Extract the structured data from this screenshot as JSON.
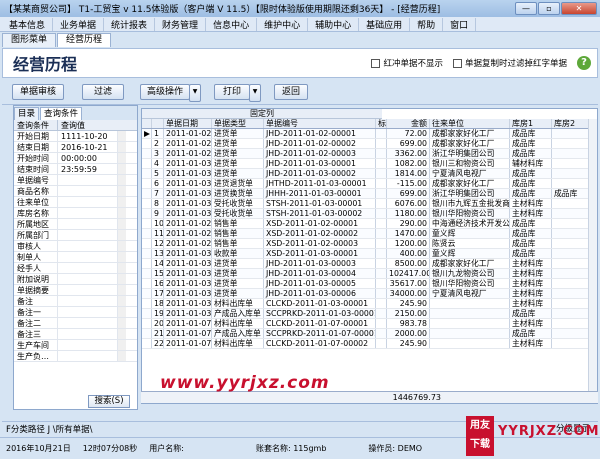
{
  "window": {
    "title": "【某某商贸公司】 T1-工贸宝 v 11.5体验版（客户端 V 11.5）【限时体验版使用期限还剩36天】 - [经营历程]",
    "btn_min": "—",
    "btn_max": "▫",
    "btn_close": "✕"
  },
  "menu": [
    "基本信息",
    "业务单据",
    "统计报表",
    "财务管理",
    "信息中心",
    "维护中心",
    "辅助中心",
    "基础应用",
    "帮助",
    "窗口"
  ],
  "tabs": [
    "图形菜单",
    "经营历程"
  ],
  "header": {
    "title": "经营历程",
    "chk1": "红冲单据不显示",
    "chk2": "单据复制时过滤掉红字单据",
    "help": "?"
  },
  "toolbar": {
    "btn_review": "单据审核",
    "btn_filter": "过滤",
    "btn_advanced": "高级操作",
    "btn_print": "打印",
    "btn_back": "返回"
  },
  "left": {
    "tab1": "目录",
    "tab2": "查询条件",
    "col1": "查询条件",
    "col2": "查询值",
    "rows": [
      {
        "k": "开始日期",
        "v": "1111-10-20"
      },
      {
        "k": "结束日期",
        "v": "2016-10-21"
      },
      {
        "k": "开始时间",
        "v": "00:00:00"
      },
      {
        "k": "结束时间",
        "v": "23:59:59"
      },
      {
        "k": "单据编号",
        "v": ""
      },
      {
        "k": "商品名称",
        "v": ""
      },
      {
        "k": "往来单位",
        "v": ""
      },
      {
        "k": "库房名称",
        "v": ""
      },
      {
        "k": "所属地区",
        "v": ""
      },
      {
        "k": "所属部门",
        "v": ""
      },
      {
        "k": "审核人",
        "v": ""
      },
      {
        "k": "制单人",
        "v": ""
      },
      {
        "k": "经手人",
        "v": ""
      },
      {
        "k": "附加说明",
        "v": ""
      },
      {
        "k": "单据摘要",
        "v": ""
      },
      {
        "k": "备注",
        "v": ""
      },
      {
        "k": "备注一",
        "v": ""
      },
      {
        "k": "备注二",
        "v": ""
      },
      {
        "k": "备注三",
        "v": ""
      },
      {
        "k": "生产车间",
        "v": ""
      },
      {
        "k": "生产负…",
        "v": ""
      }
    ],
    "search_btn": "搜索(S)"
  },
  "grid": {
    "fixed_label": "固定列",
    "headers": [
      "",
      "",
      "单据日期",
      "单据类型",
      "单据编号",
      "标记",
      "金额",
      "往来单位",
      "库房1",
      "库房2"
    ],
    "rows": [
      [
        "▶",
        "1",
        "2011-01-02",
        "进货单",
        "JHD-2011-01-02-00001",
        "",
        "72.00",
        "成都家家好化工厂",
        "成品库",
        ""
      ],
      [
        "",
        "2",
        "2011-01-02",
        "进货单",
        "JHD-2011-01-02-00002",
        "",
        "699.00",
        "成都家家好化工厂",
        "成品库",
        ""
      ],
      [
        "",
        "3",
        "2011-01-02",
        "进货单",
        "JHD-2011-01-02-00003",
        "",
        "3362.00",
        "浙江华明集团公司",
        "成品库",
        ""
      ],
      [
        "",
        "4",
        "2011-01-03",
        "进货单",
        "JHD-2011-01-03-00001",
        "",
        "1082.00",
        "银川三和物资公司",
        "辅材料库",
        ""
      ],
      [
        "",
        "5",
        "2011-01-03",
        "进货单",
        "JHD-2011-01-03-00002",
        "",
        "1814.00",
        "宁夏清风电视厂",
        "成品库",
        ""
      ],
      [
        "",
        "6",
        "2011-01-03",
        "进货退货单",
        "JHTHD-2011-01-03-00001",
        "",
        "-115.00",
        "成都家家好化工厂",
        "成品库",
        ""
      ],
      [
        "",
        "7",
        "2011-01-03",
        "进货换货单",
        "JHHH-2011-01-03-00001",
        "",
        "699.00",
        "浙江华明集团公司",
        "成品库",
        "成品库"
      ],
      [
        "",
        "8",
        "2011-01-03",
        "受托收货单",
        "STSH-2011-01-03-00001",
        "",
        "6076.00",
        "银川市九辉五金批发商",
        "主材料库",
        ""
      ],
      [
        "",
        "9",
        "2011-01-03",
        "受托收货单",
        "STSH-2011-01-03-00002",
        "",
        "1180.00",
        "银川华阳物资公司",
        "主材料库",
        ""
      ],
      [
        "",
        "10",
        "2011-01-02",
        "销售单",
        "XSD-2011-01-02-00001",
        "",
        "290.00",
        "中海通经济技术开发公",
        "成品库",
        ""
      ],
      [
        "",
        "11",
        "2011-01-02",
        "销售单",
        "XSD-2011-01-02-00002",
        "",
        "1470.00",
        "童义辉",
        "成品库",
        ""
      ],
      [
        "",
        "12",
        "2011-01-02",
        "销售单",
        "XSD-2011-01-02-00003",
        "",
        "1200.00",
        "陈贤云",
        "成品库",
        ""
      ],
      [
        "",
        "13",
        "2011-01-03",
        "收款单",
        "XSD-2011-01-03-00001",
        "",
        "400.00",
        "童义辉",
        "成品库",
        ""
      ],
      [
        "",
        "14",
        "2011-01-03",
        "进货单",
        "JHD-2011-01-03-00003",
        "",
        "8500.00",
        "成都家家好化工厂",
        "主材料库",
        ""
      ],
      [
        "",
        "15",
        "2011-01-03",
        "进货单",
        "JHD-2011-01-03-00004",
        "",
        "102417.00",
        "银川九龙物资公司",
        "主材料库",
        ""
      ],
      [
        "",
        "16",
        "2011-01-03",
        "进货单",
        "JHD-2011-01-03-00005",
        "",
        "35617.00",
        "银川华阳物资公司",
        "主材料库",
        ""
      ],
      [
        "",
        "17",
        "2011-01-03",
        "进货单",
        "JHD-2011-01-03-00006",
        "",
        "34000.00",
        "宁夏清风电视厂",
        "主材料库",
        ""
      ],
      [
        "",
        "18",
        "2011-01-03",
        "材料出库单",
        "CLCKD-2011-01-03-00001",
        "",
        "245.90",
        "",
        "主材料库",
        ""
      ],
      [
        "",
        "19",
        "2011-01-03",
        "产成品入库单",
        "SCCPRKD-2011-01-03-00001",
        "",
        "2150.00",
        "",
        "成品库",
        ""
      ],
      [
        "",
        "20",
        "2011-01-07",
        "材料出库单",
        "CLCKD-2011-01-07-00001",
        "",
        "983.78",
        "",
        "主材料库",
        ""
      ],
      [
        "",
        "21",
        "2011-01-07",
        "产成品入库单",
        "SCCPRKD-2011-01-07-00001",
        "",
        "2000.00",
        "",
        "成品库",
        ""
      ],
      [
        "",
        "22",
        "2011-01-07",
        "材料出库单",
        "CLCKD-2011-01-07-00002",
        "",
        "245.90",
        "",
        "主材料库",
        ""
      ]
    ],
    "total": "1446769.73"
  },
  "watermark": "www.yyrjxz.com",
  "pathbar": {
    "path": "F分类路径 J  \\所有单据\\",
    "page": "分级显示"
  },
  "status": {
    "date": "2016年10月21日",
    "time": "12时07分08秒",
    "user_label": "用户名称:",
    "account": "账套名称: 115gmb",
    "operator": "操作员: DEMO"
  },
  "logo": {
    "a": "用友下载",
    "b": "YYRJXZ.COM"
  }
}
